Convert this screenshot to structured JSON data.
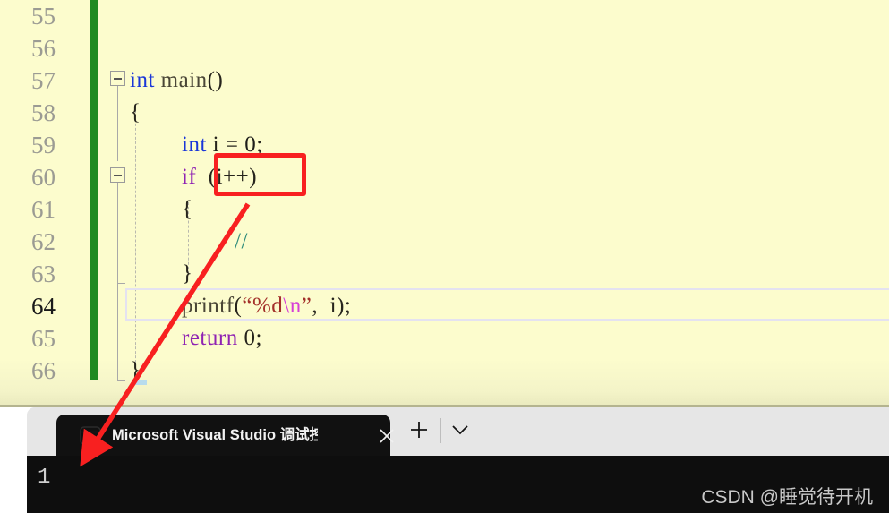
{
  "editor": {
    "language": "c",
    "background_color": "#fcfccd",
    "change_bar_color": "#1f8a20",
    "current_line_number": 64,
    "gutter": {
      "line_numbers": [
        "55",
        "56",
        "57",
        "58",
        "59",
        "60",
        "61",
        "62",
        "63",
        "64",
        "65",
        "66"
      ]
    },
    "lines": [
      {
        "number": "55",
        "text": ""
      },
      {
        "number": "56",
        "text": ""
      },
      {
        "number": "57",
        "text": "int main()"
      },
      {
        "number": "58",
        "text": "{"
      },
      {
        "number": "59",
        "text": "    int i = 0;"
      },
      {
        "number": "60",
        "text": "    if (i++)"
      },
      {
        "number": "61",
        "text": "    {"
      },
      {
        "number": "62",
        "text": "        //"
      },
      {
        "number": "63",
        "text": "    }"
      },
      {
        "number": "64",
        "text": "    printf(\"%d\\n\", i);"
      },
      {
        "number": "65",
        "text": "    return 0;"
      },
      {
        "number": "66",
        "text": "}"
      }
    ],
    "tokens": {
      "int_keyword": "int",
      "main_identifier": "main",
      "paren_empty": "()",
      "open_brace": "{",
      "close_brace": "}",
      "int_decl": "int",
      "var_i": "i",
      "assign": "=",
      "zero": "0",
      "semicolon": ";",
      "if_keyword": "if",
      "if_condition": "(i++)",
      "comment": "//",
      "printf_identifier": "printf",
      "printf_open": "(",
      "printf_string_start": "“%d",
      "printf_escape": "\\n",
      "printf_string_end": "”",
      "printf_comma": ",",
      "printf_arg": "i",
      "printf_close": ");",
      "return_keyword": "return",
      "return_value": "0;"
    },
    "syntax_colors": {
      "keyword_blue": "#1a36d8",
      "keyword_purple": "#8f23b3",
      "function": "#4a4636",
      "string": "#a3312a",
      "escape": "#d63fd6",
      "comment": "#2e8b7a",
      "plain": "#26241c"
    }
  },
  "annotation": {
    "highlight_box_color": "#f82020",
    "highlight_target": "(i++)",
    "arrow_color": "#f82020",
    "arrow_from": "(i++) condition",
    "arrow_to": "console output 1"
  },
  "terminal": {
    "window_background": "#e6e6e6",
    "console_background": "#0e0e0e",
    "tab": {
      "icon": "cmd-console-icon",
      "title": "Microsoft Visual Studio 调试控",
      "close_label": "✕"
    },
    "new_tab_label": "+",
    "dropdown_label": "⌄",
    "output_lines": [
      "1"
    ]
  },
  "watermark": {
    "text": "CSDN @睡觉待开机"
  }
}
